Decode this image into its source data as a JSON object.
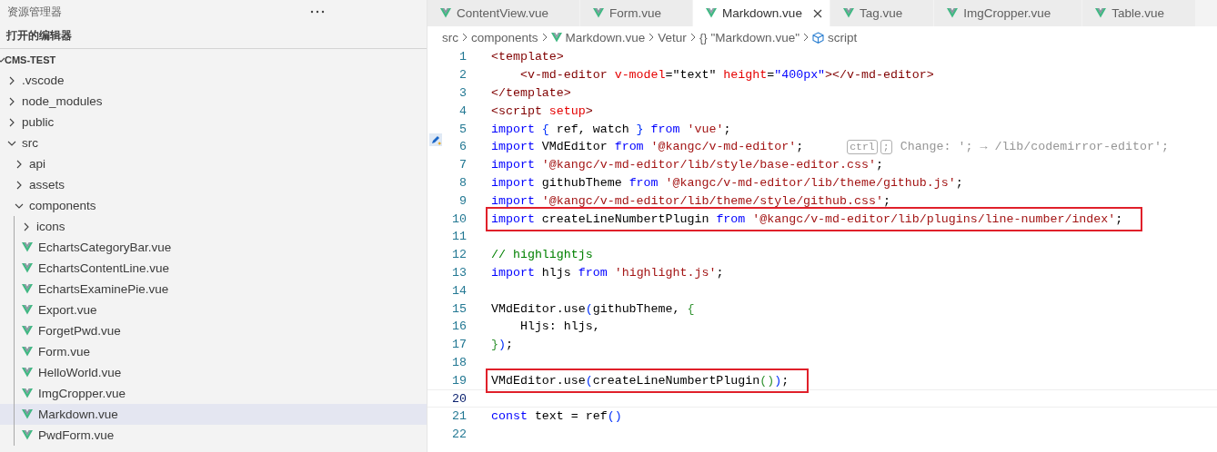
{
  "sidebar": {
    "title": "资源管理器",
    "open_editors": "打开的编辑器",
    "project": {
      "label": "CMS-TEST",
      "expanded": true,
      "children": [
        {
          "label": ".vscode",
          "kind": "folder",
          "expanded": false,
          "selected": false
        },
        {
          "label": "node_modules",
          "kind": "folder",
          "expanded": false,
          "selected": false
        },
        {
          "label": "public",
          "kind": "folder",
          "expanded": false,
          "selected": false
        },
        {
          "label": "src",
          "kind": "folder",
          "expanded": true,
          "selected": false,
          "children": [
            {
              "label": "api",
              "kind": "folder",
              "expanded": false,
              "selected": false
            },
            {
              "label": "assets",
              "kind": "folder",
              "expanded": false,
              "selected": false
            },
            {
              "label": "components",
              "kind": "folder",
              "expanded": true,
              "selected": false,
              "children": [
                {
                  "label": "icons",
                  "kind": "folder",
                  "expanded": false,
                  "selected": false
                },
                {
                  "label": "EchartsCategoryBar.vue",
                  "kind": "vue",
                  "selected": false
                },
                {
                  "label": "EchartsContentLine.vue",
                  "kind": "vue",
                  "selected": false
                },
                {
                  "label": "EchartsExaminePie.vue",
                  "kind": "vue",
                  "selected": false
                },
                {
                  "label": "Export.vue",
                  "kind": "vue",
                  "selected": false
                },
                {
                  "label": "ForgetPwd.vue",
                  "kind": "vue",
                  "selected": false
                },
                {
                  "label": "Form.vue",
                  "kind": "vue",
                  "selected": false
                },
                {
                  "label": "HelloWorld.vue",
                  "kind": "vue",
                  "selected": false
                },
                {
                  "label": "ImgCropper.vue",
                  "kind": "vue",
                  "selected": false
                },
                {
                  "label": "Markdown.vue",
                  "kind": "vue",
                  "selected": true
                },
                {
                  "label": "PwdForm.vue",
                  "kind": "vue",
                  "selected": false
                }
              ]
            }
          ]
        }
      ]
    }
  },
  "tabs": [
    {
      "label": "ContentView.vue",
      "selected": false
    },
    {
      "label": "Form.vue",
      "selected": false
    },
    {
      "label": "Markdown.vue",
      "selected": true
    },
    {
      "label": "Tag.vue",
      "selected": false
    },
    {
      "label": "ImgCropper.vue",
      "selected": false
    },
    {
      "label": "Table.vue",
      "selected": false
    }
  ],
  "breadcrumb": [
    {
      "kind": "text",
      "label": "src"
    },
    {
      "kind": "text",
      "label": "components"
    },
    {
      "kind": "vue",
      "label": "Markdown.vue"
    },
    {
      "kind": "text",
      "label": "Vetur"
    },
    {
      "kind": "braces",
      "glyph": "{}",
      "label": "\"Markdown.vue\""
    },
    {
      "kind": "cube",
      "label": "script"
    }
  ],
  "code": [
    {
      "number": "1",
      "tokens": [
        {
          "kind": "tag",
          "text": "<template>"
        }
      ]
    },
    {
      "number": "2",
      "tokens": [
        {
          "kind": "tag",
          "text": "    <v-md-editor "
        },
        {
          "kind": "attr",
          "text": "v-model"
        },
        {
          "kind": "plain",
          "text": "=\"text\" "
        },
        {
          "kind": "attr",
          "text": "height"
        },
        {
          "kind": "plain",
          "text": "="
        },
        {
          "kind": "value",
          "text": "\"400px\""
        },
        {
          "kind": "tag",
          "text": "></v-md-editor>"
        }
      ]
    },
    {
      "number": "3",
      "tokens": [
        {
          "kind": "tag",
          "text": "</template>"
        }
      ]
    },
    {
      "number": "4",
      "tokens": [
        {
          "kind": "tag",
          "text": "<script "
        },
        {
          "kind": "attr",
          "text": "setup"
        },
        {
          "kind": "tag",
          "text": ">"
        }
      ]
    },
    {
      "number": "5",
      "tokens": [
        {
          "kind": "keyword",
          "text": "import "
        },
        {
          "kind": "bracket1",
          "text": "{"
        },
        {
          "kind": "plain",
          "text": " ref, watch "
        },
        {
          "kind": "bracket1",
          "text": "} "
        },
        {
          "kind": "keyword",
          "text": "from "
        },
        {
          "kind": "string",
          "text": "'vue'"
        },
        {
          "kind": "plain",
          "text": ";"
        }
      ]
    },
    {
      "number": "6",
      "suggestion": true,
      "tokens": [
        {
          "kind": "keyword",
          "text": "import"
        },
        {
          "kind": "plain",
          "text": " VMdEditor "
        },
        {
          "kind": "keyword",
          "text": "from "
        },
        {
          "kind": "string",
          "text": "'@kangc/v-md-editor'"
        },
        {
          "kind": "plain",
          "text": ";"
        }
      ],
      "hint": {
        "keys": [
          "ctrl",
          ";"
        ],
        "text": "Change: '; → /lib/codemirror-editor';"
      }
    },
    {
      "number": "7",
      "tokens": [
        {
          "kind": "keyword",
          "text": "import "
        },
        {
          "kind": "string",
          "text": "'@kangc/v-md-editor/lib/style/base-editor.css'"
        },
        {
          "kind": "plain",
          "text": ";"
        }
      ]
    },
    {
      "number": "8",
      "tokens": [
        {
          "kind": "keyword",
          "text": "import"
        },
        {
          "kind": "plain",
          "text": " githubTheme "
        },
        {
          "kind": "keyword",
          "text": "from "
        },
        {
          "kind": "string",
          "text": "'@kangc/v-md-editor/lib/theme/github.js'"
        },
        {
          "kind": "plain",
          "text": ";"
        }
      ]
    },
    {
      "number": "9",
      "tokens": [
        {
          "kind": "keyword",
          "text": "import "
        },
        {
          "kind": "string",
          "text": "'@kangc/v-md-editor/lib/theme/style/github.css'"
        },
        {
          "kind": "plain",
          "text": ";"
        }
      ]
    },
    {
      "number": "10",
      "boxed": true,
      "tokens": [
        {
          "kind": "keyword",
          "text": "import"
        },
        {
          "kind": "plain",
          "text": " createLineNumbertPlugin "
        },
        {
          "kind": "keyword",
          "text": "from "
        },
        {
          "kind": "string",
          "text": "'@kangc/v-md-editor/lib/plugins/line-number/index'"
        },
        {
          "kind": "plain",
          "text": ";"
        }
      ]
    },
    {
      "number": "11"
    },
    {
      "number": "12",
      "tokens": [
        {
          "kind": "comment",
          "text": "// highlightjs"
        }
      ]
    },
    {
      "number": "13",
      "tokens": [
        {
          "kind": "keyword",
          "text": "import"
        },
        {
          "kind": "plain",
          "text": " hljs "
        },
        {
          "kind": "keyword",
          "text": "from "
        },
        {
          "kind": "string",
          "text": "'highlight.js'"
        },
        {
          "kind": "plain",
          "text": ";"
        }
      ]
    },
    {
      "number": "14"
    },
    {
      "number": "15",
      "tokens": [
        {
          "kind": "plain",
          "text": "VMdEditor.use"
        },
        {
          "kind": "bracket1",
          "text": "("
        },
        {
          "kind": "plain",
          "text": "githubTheme, "
        },
        {
          "kind": "bracket2",
          "text": "{"
        }
      ]
    },
    {
      "number": "16",
      "tokens": [
        {
          "kind": "plain",
          "text": "    Hljs: hljs,"
        }
      ]
    },
    {
      "number": "17",
      "tokens": [
        {
          "kind": "bracket2",
          "text": "}"
        },
        {
          "kind": "bracket1",
          "text": ")"
        },
        {
          "kind": "plain",
          "text": ";"
        }
      ]
    },
    {
      "number": "18"
    },
    {
      "number": "19",
      "boxed": true,
      "tokens": [
        {
          "kind": "plain",
          "text": "VMdEditor.use"
        },
        {
          "kind": "bracket1",
          "text": "("
        },
        {
          "kind": "plain",
          "text": "createLineNumbertPlugin"
        },
        {
          "kind": "bracket2",
          "text": "()"
        },
        {
          "kind": "bracket1",
          "text": ")"
        },
        {
          "kind": "plain",
          "text": ";"
        }
      ]
    },
    {
      "number": "20",
      "current": true
    },
    {
      "number": "21",
      "tokens": [
        {
          "kind": "keyword",
          "text": "const"
        },
        {
          "kind": "plain",
          "text": " text = ref"
        },
        {
          "kind": "bracket1",
          "text": "()"
        }
      ]
    },
    {
      "number": "22"
    }
  ]
}
